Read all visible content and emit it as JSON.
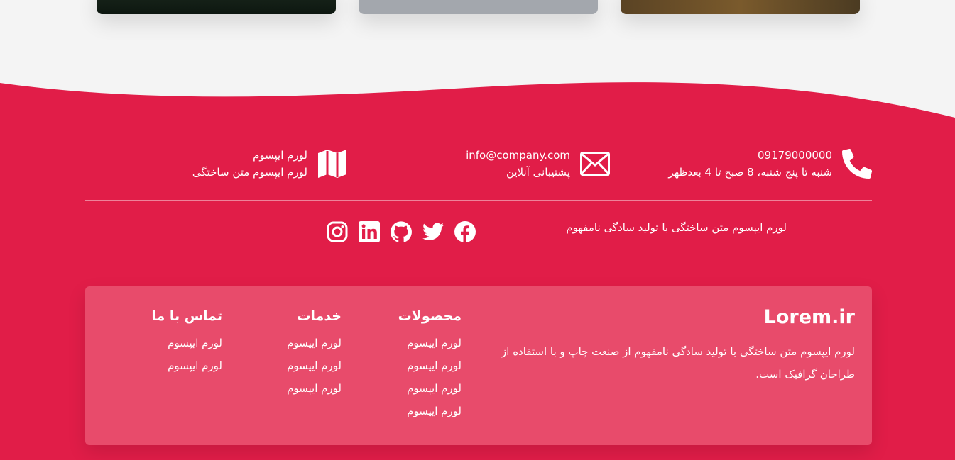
{
  "colors": {
    "footer_bg": "#e11d48",
    "panel_bg": "#e84b6b",
    "page_bg": "#f4f4f4",
    "text": "#ffffff"
  },
  "contacts": [
    {
      "icon": "phone-icon",
      "line1": "09179000000",
      "line2": "شنبه تا پنج شنبه، 8 صبح تا 4 بعدظهر"
    },
    {
      "icon": "envelope-icon",
      "line1": "info@company.com",
      "line2": "پشتیبانی آنلاین"
    },
    {
      "icon": "map-icon",
      "line1": "لورم ایپسوم",
      "line2": "لورم ایپسوم متن ساختگی"
    }
  ],
  "tagline": "لورم ایپسوم متن ساختگی با تولید سادگی نامفهوم",
  "socials": [
    "facebook-icon",
    "twitter-icon",
    "github-icon",
    "linkedin-icon",
    "instagram-icon"
  ],
  "brand": {
    "title": "Lorem.ir",
    "description": "لورم ایپسوم متن ساختگی با تولید سادگی نامفهوم از صنعت چاپ و با استفاده از طراحان گرافیک است."
  },
  "columns": [
    {
      "title": "محصولات",
      "items": [
        "لورم ایپسوم",
        "لورم ایپسوم",
        "لورم ایپسوم",
        "لورم ایپسوم"
      ]
    },
    {
      "title": "خدمات",
      "items": [
        "لورم ایپسوم",
        "لورم ایپسوم",
        "لورم ایپسوم"
      ]
    },
    {
      "title": "تماس با ما",
      "items": [
        "لورم ایپسوم",
        "لورم ایپسوم"
      ]
    }
  ]
}
